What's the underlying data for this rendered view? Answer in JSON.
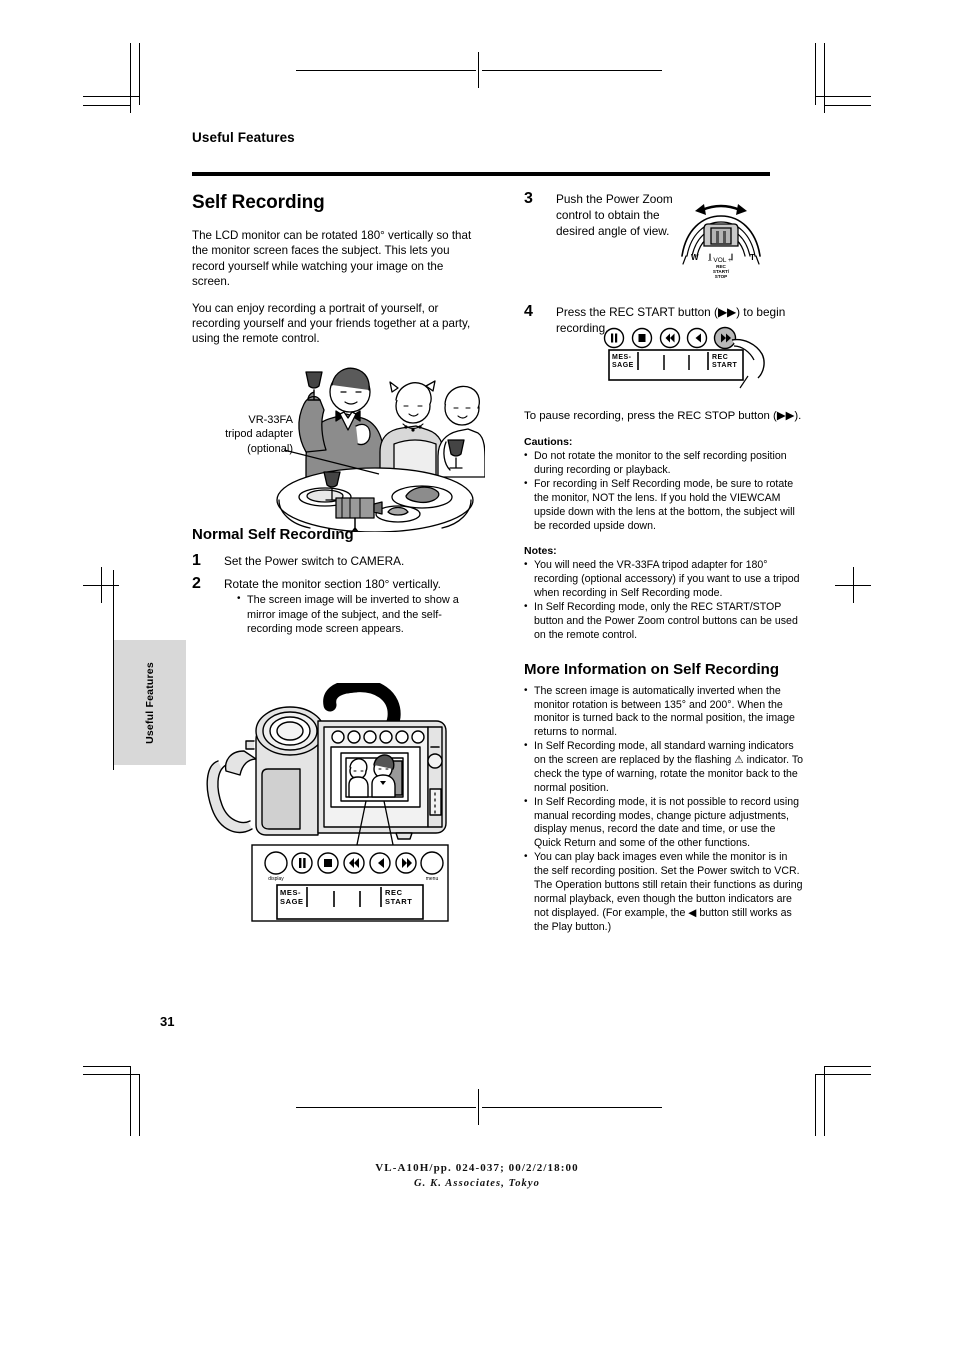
{
  "running_head": "Useful Features",
  "section": {
    "title": "Self Recording",
    "intro1": "The LCD monitor can be rotated 180° vertically so that the monitor screen faces the subject. This lets you record yourself while watching your image on the screen.",
    "intro2": "You can enjoy recording a portrait of yourself, or recording yourself and your friends together at a party, using the remote control."
  },
  "party_caption": {
    "line1": "VR-33FA",
    "line2": "tripod adapter",
    "line3": "(optional)"
  },
  "normal_self_recording": {
    "title": "Normal Self Recording",
    "steps": [
      {
        "num": "1",
        "text": "Set the Power switch to CAMERA.",
        "bullets": []
      },
      {
        "num": "2",
        "text": "Rotate the monitor section 180° vertically.",
        "bullets": [
          "The screen image will be inverted to show a mirror image of the subject, and the self-recording mode screen appears."
        ]
      }
    ]
  },
  "right_steps": [
    {
      "num": "3",
      "text": "Push the Power Zoom control to obtain the desired angle of view."
    },
    {
      "num": "4",
      "text": "Press the REC START button (▶▶) to begin recording."
    }
  ],
  "pause_text": "To pause recording, press the REC STOP button (▶▶).",
  "cautions": {
    "title": "Cautions:",
    "items": [
      "Do not rotate the monitor to the self recording position during recording or playback.",
      "For recording in Self Recording mode, be sure to rotate the monitor, NOT the lens. If you hold the VIEWCAM upside down with the lens at the bottom, the subject will be recorded upside down."
    ]
  },
  "notes": {
    "title": "Notes:",
    "items": [
      "You will need the VR-33FA tripod adapter for 180° recording (optional accessory) if you want to use a tripod when recording in Self Recording mode.",
      "In Self Recording mode, only the REC START/STOP button and the Power Zoom control buttons can be used on the remote control."
    ]
  },
  "more_info": {
    "title": "More Information on Self Recording",
    "items": [
      "The screen image is automatically inverted when the monitor rotation is between 135° and 200°. When the monitor is turned back to the normal position, the image returns to normal.",
      "In Self Recording mode, all standard warning indicators on the screen are replaced by the flashing ⚠ indicator. To check the type of warning, rotate the monitor back to the normal position.",
      "In Self Recording mode, it is not possible to record using manual recording modes, change picture adjustments, display menus, record the date and time, or use the Quick Return and some of the other functions.",
      "You can play back images even while the monitor is in the self recording position. Set the Power switch to VCR. The Operation buttons still retain their functions as during normal playback, even though the button indicators are not displayed. (For example, the ◀ button still works as the Play button.)"
    ]
  },
  "zoom_control_labels": {
    "w": "W",
    "t": "T",
    "vol": "– VOL +",
    "rec": "REC",
    "start": "START/",
    "stop": "STOP"
  },
  "remote_display_labels": {
    "message_l1": "MES-",
    "message_l2": "SAGE",
    "rec_l1": "REC",
    "rec_l2": "START"
  },
  "camera_button_labels": {
    "left": "display",
    "right": "menu"
  },
  "side_tab": "Useful Features",
  "page_number": "31",
  "footer": {
    "line1": "VL-A10H/pp. 024-037; 00/2/2/18:00",
    "line2": "G. K. Associates, Tokyo"
  }
}
